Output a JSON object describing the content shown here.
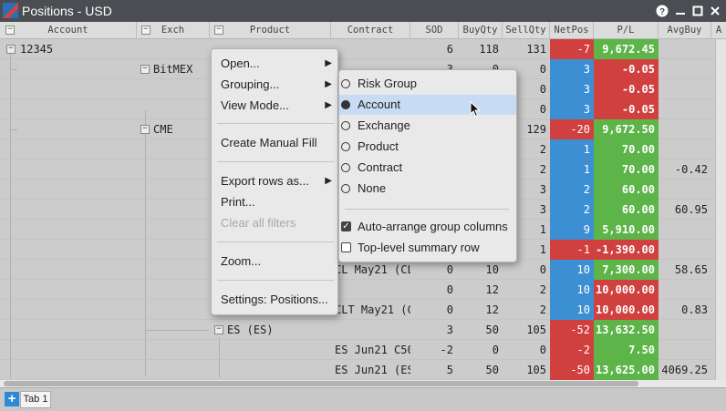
{
  "window": {
    "title": "Positions - USD",
    "help": "?",
    "minimize": "—",
    "maximize": "□",
    "close": "✕"
  },
  "columns": [
    "Account",
    "Exch",
    "Product",
    "Contract",
    "SOD",
    "BuyQty",
    "SellQty",
    "NetPos",
    "P/L",
    "AvgBuy",
    "A"
  ],
  "collapse_glyph": "−",
  "rows": [
    {
      "account": "12345",
      "exch": "",
      "product": "",
      "contract": "",
      "sod": "6",
      "buy": "118",
      "sell": "131",
      "netpos": "-7",
      "pl": "9,672.45",
      "avgbuy": ""
    },
    {
      "account": "",
      "exch": "BitMEX",
      "product": "",
      "contract": "",
      "sod": "3",
      "buy": "0",
      "sell": "0",
      "netpos": "3",
      "pl": "-0.05",
      "avgbuy": ""
    },
    {
      "account": "",
      "exch": "",
      "product": "",
      "contract": "",
      "sod": "",
      "buy": "",
      "sell": "0",
      "netpos": "3",
      "pl": "-0.05",
      "avgbuy": ""
    },
    {
      "account": "",
      "exch": "",
      "product": "",
      "contract": "",
      "sod": "",
      "buy": "",
      "sell": "0",
      "netpos": "3",
      "pl": "-0.05",
      "avgbuy": ""
    },
    {
      "account": "",
      "exch": "CME",
      "product": "",
      "contract": "",
      "sod": "",
      "buy": "",
      "sell": "129",
      "netpos": "-20",
      "pl": "9,672.50",
      "avgbuy": ""
    },
    {
      "account": "",
      "exch": "",
      "product": "",
      "contract": "",
      "sod": "",
      "buy": "",
      "sell": "2",
      "netpos": "1",
      "pl": "70.00",
      "avgbuy": ""
    },
    {
      "account": "",
      "exch": "",
      "product": "",
      "contract": "",
      "sod": "",
      "buy": "",
      "sell": "2",
      "netpos": "1",
      "pl": "70.00",
      "avgbuy": "-0.42"
    },
    {
      "account": "",
      "exch": "",
      "product": "",
      "contract": "",
      "sod": "",
      "buy": "",
      "sell": "3",
      "netpos": "2",
      "pl": "60.00",
      "avgbuy": ""
    },
    {
      "account": "",
      "exch": "",
      "product": "",
      "contract": "",
      "sod": "",
      "buy": "",
      "sell": "3",
      "netpos": "2",
      "pl": "60.00",
      "avgbuy": "60.95"
    },
    {
      "account": "",
      "exch": "",
      "product": "",
      "contract": "",
      "sod": "",
      "buy": "",
      "sell": "1",
      "netpos": "9",
      "pl": "5,910.00",
      "avgbuy": ""
    },
    {
      "account": "",
      "exch": "",
      "product": "",
      "contract": "",
      "sod": "",
      "buy": "",
      "sell": "1",
      "netpos": "-1",
      "pl": "-1,390.00",
      "avgbuy": ""
    },
    {
      "account": "",
      "exch": "",
      "product": "",
      "contract": "CL May21 (CL",
      "sod": "0",
      "buy": "10",
      "sell": "0",
      "netpos": "10",
      "pl": "7,300.00",
      "avgbuy": "58.65"
    },
    {
      "account": "",
      "exch": "",
      "product": "",
      "contract": "",
      "sod": "0",
      "buy": "12",
      "sell": "2",
      "netpos": "10",
      "pl": "10,000.00",
      "avgbuy": ""
    },
    {
      "account": "",
      "exch": "",
      "product": "",
      "contract": "CLT May21 (C",
      "sod": "0",
      "buy": "12",
      "sell": "2",
      "netpos": "10",
      "pl": "10,000.00",
      "avgbuy": "0.83"
    },
    {
      "account": "",
      "exch": "",
      "product": "ES (ES)",
      "contract": "",
      "sod": "3",
      "buy": "50",
      "sell": "105",
      "netpos": "-52",
      "pl": "13,632.50",
      "avgbuy": ""
    },
    {
      "account": "",
      "exch": "",
      "product": "",
      "contract": "ES Jun21 C50",
      "sod": "-2",
      "buy": "0",
      "sell": "0",
      "netpos": "-2",
      "pl": "7.50",
      "avgbuy": ""
    },
    {
      "account": "",
      "exch": "",
      "product": "",
      "contract": "ES Jun21 (ES",
      "sod": "5",
      "buy": "50",
      "sell": "105",
      "netpos": "-50",
      "pl": "13,625.00",
      "avgbuy": "4069.25"
    }
  ],
  "context_menu": {
    "items": [
      {
        "label": "Open...",
        "submenu": true
      },
      {
        "label": "Grouping...",
        "submenu": true
      },
      {
        "label": "View Mode...",
        "submenu": true
      },
      {
        "label": "Create Manual Fill"
      },
      {
        "label": "Export rows as...",
        "submenu": true
      },
      {
        "label": "Print..."
      },
      {
        "label": "Clear all filters",
        "disabled": true
      },
      {
        "label": "Zoom..."
      },
      {
        "label": "Settings: Positions..."
      }
    ],
    "submenu_arrow": "▶"
  },
  "grouping_menu": {
    "options": [
      {
        "label": "Risk Group",
        "selected": false
      },
      {
        "label": "Account",
        "selected": true
      },
      {
        "label": "Exchange",
        "selected": false
      },
      {
        "label": "Product",
        "selected": false
      },
      {
        "label": "Contract",
        "selected": false
      },
      {
        "label": "None",
        "selected": false
      }
    ],
    "checks": [
      {
        "label": "Auto-arrange group columns",
        "checked": true
      },
      {
        "label": "Top-level summary row",
        "checked": false
      }
    ],
    "check_glyph": "✓",
    "highlight_color": "#c7dcf3"
  },
  "tabs": {
    "add": "+",
    "items": [
      "Tab 1"
    ]
  },
  "colors": {
    "netpos_negative": "#d0403e",
    "netpos_positive": "#3d8fd4",
    "pl_positive": "#5db54a",
    "pl_negative": "#d0403e"
  }
}
